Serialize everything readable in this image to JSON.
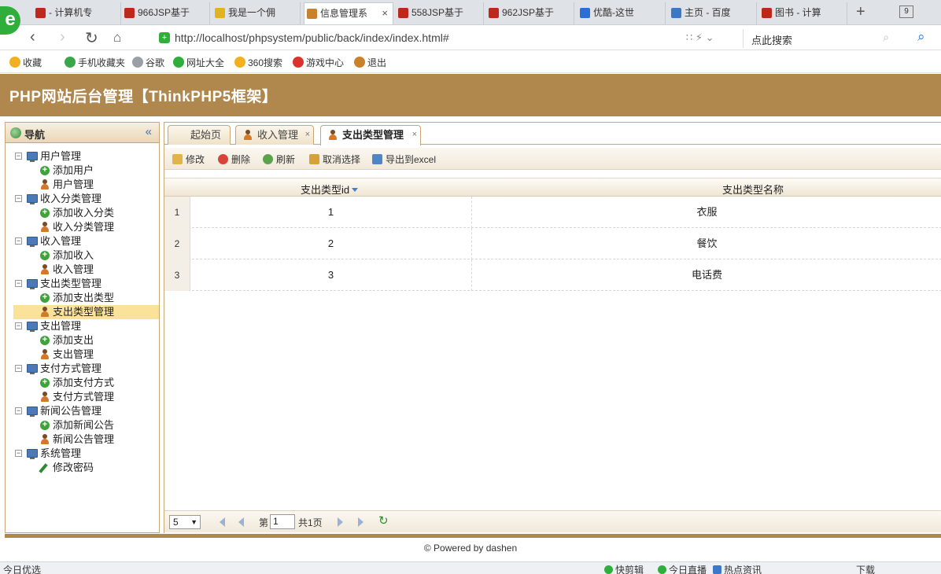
{
  "browser": {
    "tabs": [
      {
        "label": "- 计算机专",
        "color": "#c0271b",
        "active": false
      },
      {
        "label": "966JSP基于",
        "color": "#c0271b",
        "active": false
      },
      {
        "label": "我是一个佣",
        "color": "#e3b21f",
        "active": false
      },
      {
        "label": "信息管理系",
        "color": "#c9812c",
        "active": true
      },
      {
        "label": "558JSP基于",
        "color": "#c0271b",
        "active": false
      },
      {
        "label": "962JSP基于",
        "color": "#c0271b",
        "active": false
      },
      {
        "label": "优酷-这世",
        "color": "#2a6fd6",
        "active": false
      },
      {
        "label": "主页 - 百度",
        "color": "#3b78c9",
        "active": false
      },
      {
        "label": "图书 - 计算",
        "color": "#c0271b",
        "active": false
      }
    ],
    "tab_count": "9",
    "url": "http://localhost/phpsystem/public/back/index/index.html#",
    "search_placeholder": "点此搜索",
    "favorites": [
      {
        "label": "收藏",
        "color": "#f2b01e"
      },
      {
        "label": "手机收藏夹",
        "color": "#3aa64a"
      },
      {
        "label": "谷歌",
        "color": "#9aa0a6"
      },
      {
        "label": "网址大全",
        "color": "#2fae3b"
      },
      {
        "label": "360搜索",
        "color": "#f2b01e"
      },
      {
        "label": "游戏中心",
        "color": "#d9342b"
      },
      {
        "label": "退出",
        "color": "#c9812c"
      }
    ]
  },
  "app": {
    "title": "PHP网站后台管理【ThinkPHP5框架】",
    "accent": "#b0874d"
  },
  "sidebar": {
    "title": "导航",
    "groups": [
      {
        "label": "用户管理",
        "children": [
          {
            "label": "添加用户",
            "icon": "add"
          },
          {
            "label": "用户管理",
            "icon": "user"
          }
        ]
      },
      {
        "label": "收入分类管理",
        "children": [
          {
            "label": "添加收入分类",
            "icon": "add"
          },
          {
            "label": "收入分类管理",
            "icon": "user"
          }
        ]
      },
      {
        "label": "收入管理",
        "children": [
          {
            "label": "添加收入",
            "icon": "add"
          },
          {
            "label": "收入管理",
            "icon": "user"
          }
        ]
      },
      {
        "label": "支出类型管理",
        "children": [
          {
            "label": "添加支出类型",
            "icon": "add"
          },
          {
            "label": "支出类型管理",
            "icon": "user",
            "selected": true
          }
        ]
      },
      {
        "label": "支出管理",
        "children": [
          {
            "label": "添加支出",
            "icon": "add"
          },
          {
            "label": "支出管理",
            "icon": "user"
          }
        ]
      },
      {
        "label": "支付方式管理",
        "children": [
          {
            "label": "添加支付方式",
            "icon": "add"
          },
          {
            "label": "支付方式管理",
            "icon": "user"
          }
        ]
      },
      {
        "label": "新闻公告管理",
        "children": [
          {
            "label": "添加新闻公告",
            "icon": "add"
          },
          {
            "label": "新闻公告管理",
            "icon": "user"
          }
        ]
      },
      {
        "label": "系统管理",
        "children": [
          {
            "label": "修改密码",
            "icon": "pencil"
          }
        ]
      }
    ]
  },
  "main": {
    "tabs": [
      {
        "label": "起始页",
        "closable": false
      },
      {
        "label": "收入管理",
        "closable": true
      },
      {
        "label": "支出类型管理",
        "closable": true,
        "active": true
      }
    ],
    "toolbar": {
      "edit": "修改",
      "delete": "删除",
      "refresh": "刷新",
      "cancel_select": "取消选择",
      "export": "导出到excel"
    },
    "grid": {
      "columns": [
        "支出类型id",
        "支出类型名称"
      ],
      "rows": [
        {
          "num": "1",
          "id": "1",
          "name": "衣服"
        },
        {
          "num": "2",
          "id": "2",
          "name": "餐饮"
        },
        {
          "num": "3",
          "id": "3",
          "name": "电话费"
        }
      ]
    },
    "pager": {
      "page_size": "5",
      "page_prefix": "第",
      "page_value": "1",
      "page_total": "共1页"
    }
  },
  "footer": "© Powered by dashen",
  "statusbar": {
    "left": "今日优选",
    "items": [
      "快剪辑",
      "今日直播",
      "热点资讯",
      "下载"
    ]
  }
}
